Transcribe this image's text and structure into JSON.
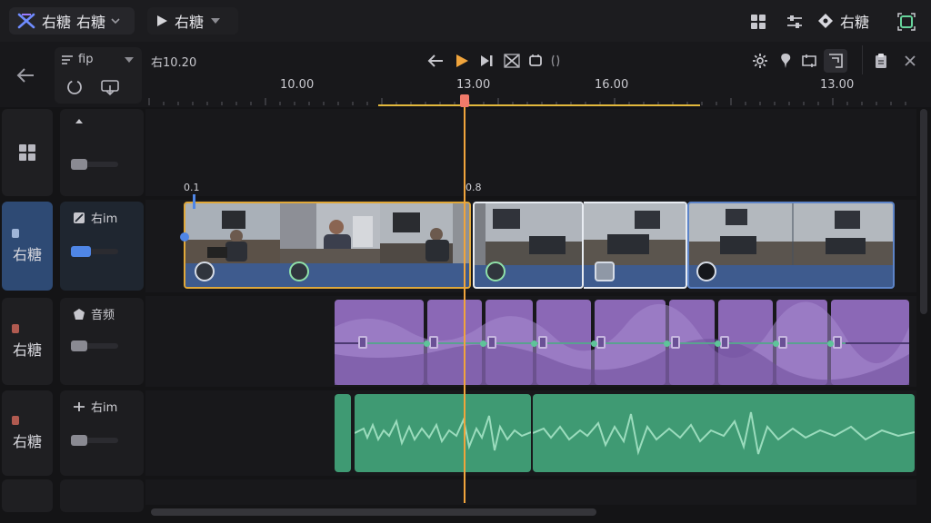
{
  "topbar": {
    "project_name_1": "右糖",
    "project_name_2": "右糖",
    "play_title": "右糖",
    "right_label": "右糖"
  },
  "track_tools": {
    "fit_label": "fip"
  },
  "timecode": "右10.20",
  "ruler": {
    "labels": [
      "10.00",
      "13.00",
      "16.00",
      "13.00"
    ]
  },
  "markers": {
    "left": "0.1",
    "right": "0.8"
  },
  "lanes": [
    {
      "head_label": "",
      "ctl_label": ""
    },
    {
      "head_label": "右糖",
      "ctl_label": "右im"
    },
    {
      "head_label": "右糖",
      "ctl_label": "音频"
    },
    {
      "head_label": "右糖",
      "ctl_label": "右im"
    }
  ],
  "colors": {
    "accent_orange": "#f0a43c",
    "video_blue": "#3e5b8e",
    "audio_purple": "#8b68b6",
    "audio_green": "#3f9a73"
  },
  "icons": [
    "logo-icon",
    "chevron-down-icon",
    "play-icon",
    "grid-icon",
    "sliders-icon",
    "diamond-icon",
    "focus-icon",
    "back-arrow-icon",
    "loop-icon",
    "export-icon",
    "grid-small-icon",
    "arrow-left-icon",
    "play-yellow-icon",
    "skip-end-icon",
    "cut-icon",
    "crop-icon",
    "settings-icon",
    "pin-icon",
    "trim-icon",
    "frame-icon",
    "clipboard-icon",
    "close-icon"
  ]
}
